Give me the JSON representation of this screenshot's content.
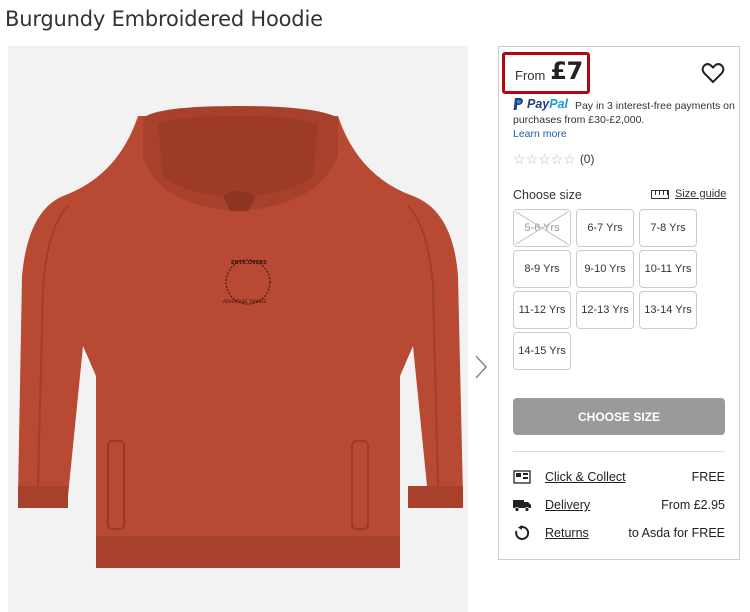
{
  "product": {
    "title": "Burgundy Embroidered Hoodie",
    "image_alt": "Burgundy embroidered hoodie",
    "embroidery_top": "ENTR.OVERS",
    "embroidery_bottom": "ADVENTURE THRIVES"
  },
  "price": {
    "from_label": "From",
    "value": "£7"
  },
  "paypal": {
    "brand_pay": "Pay",
    "brand_pal": "Pal",
    "text": "Pay in 3 interest-free payments on purchases from £30-£2,000.",
    "learn_more": "Learn more"
  },
  "rating": {
    "stars": 0,
    "count": "(0)"
  },
  "size": {
    "label": "Choose size",
    "guide_label": "Size guide",
    "options": [
      {
        "label": "5-6 Yrs",
        "available": false
      },
      {
        "label": "6-7 Yrs",
        "available": true
      },
      {
        "label": "7-8 Yrs",
        "available": true
      },
      {
        "label": "8-9 Yrs",
        "available": true
      },
      {
        "label": "9-10 Yrs",
        "available": true
      },
      {
        "label": "10-11 Yrs",
        "available": true
      },
      {
        "label": "11-12 Yrs",
        "available": true
      },
      {
        "label": "12-13 Yrs",
        "available": true
      },
      {
        "label": "13-14 Yrs",
        "available": true
      },
      {
        "label": "14-15 Yrs",
        "available": true
      }
    ]
  },
  "cta": {
    "label": "CHOOSE SIZE"
  },
  "delivery": [
    {
      "icon": "store-icon",
      "label": "Click & Collect",
      "value": "FREE"
    },
    {
      "icon": "truck-icon",
      "label": "Delivery",
      "value": "From £2.95"
    },
    {
      "icon": "returns-icon",
      "label": "Returns",
      "value": "to Asda for FREE"
    }
  ],
  "colors": {
    "accent_red": "#b3070f",
    "hoodie": "#b84a33",
    "cta_disabled": "#9a9a9a",
    "link": "#1a5ca8"
  }
}
